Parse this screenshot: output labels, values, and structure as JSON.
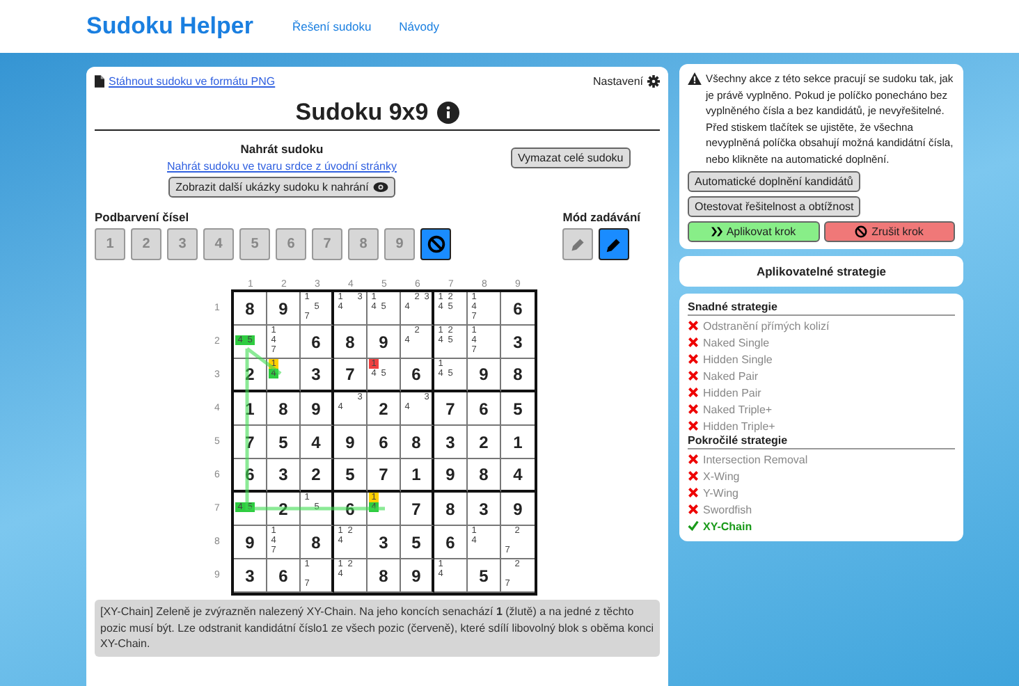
{
  "nav": {
    "brand": "Sudoku Helper",
    "links": [
      "Řešení sudoku",
      "Návody"
    ]
  },
  "editor": {
    "download_link": "Stáhnout sudoku ve formátu PNG",
    "settings": "Nastavení",
    "title": "Sudoku 9x9",
    "upload": {
      "heading": "Nahrát sudoku",
      "link": "Nahrát sudoku ve tvaru srdce z úvodní stránky",
      "button": "Zobrazit další ukázky sudoku k nahrání"
    },
    "clear_button": "Vymazat celé sudoku",
    "coloring": {
      "label": "Podbarvení čísel",
      "buttons": [
        {
          "kind": "digit",
          "label": "1",
          "selected": false
        },
        {
          "kind": "digit",
          "label": "2",
          "selected": false
        },
        {
          "kind": "digit",
          "label": "3",
          "selected": false
        },
        {
          "kind": "digit",
          "label": "4",
          "selected": false
        },
        {
          "kind": "digit",
          "label": "5",
          "selected": false
        },
        {
          "kind": "digit",
          "label": "6",
          "selected": false
        },
        {
          "kind": "digit",
          "label": "7",
          "selected": false
        },
        {
          "kind": "digit",
          "label": "8",
          "selected": false
        },
        {
          "kind": "digit",
          "label": "9",
          "selected": false
        },
        {
          "kind": "none",
          "selected": true
        }
      ]
    },
    "input_mode": {
      "label": "Mód zadávání",
      "buttons": [
        {
          "kind": "pen",
          "selected": false
        },
        {
          "kind": "pencil",
          "selected": true
        }
      ]
    },
    "column_headers": [
      "1",
      "2",
      "3",
      "4",
      "5",
      "6",
      "7",
      "8",
      "9"
    ],
    "row_headers": [
      "1",
      "2",
      "3",
      "4",
      "5",
      "6",
      "7",
      "8",
      "9"
    ],
    "grid": [
      [
        {
          "value": "8"
        },
        {
          "value": "9"
        },
        {
          "candidates": [
            {
              "digit": "1"
            },
            {
              "digit": "5"
            },
            {
              "digit": "7"
            }
          ]
        },
        {
          "candidates": [
            {
              "digit": "1"
            },
            {
              "digit": "3"
            },
            {
              "digit": "4"
            }
          ]
        },
        {
          "candidates": [
            {
              "digit": "1"
            },
            {
              "digit": "4"
            },
            {
              "digit": "5"
            }
          ]
        },
        {
          "candidates": [
            {
              "digit": "2"
            },
            {
              "digit": "3"
            },
            {
              "digit": "4"
            }
          ]
        },
        {
          "candidates": [
            {
              "digit": "1"
            },
            {
              "digit": "2"
            },
            {
              "digit": "4"
            },
            {
              "digit": "5"
            }
          ]
        },
        {
          "candidates": [
            {
              "digit": "1"
            },
            {
              "digit": "4"
            },
            {
              "digit": "7"
            }
          ]
        },
        {
          "value": "6"
        }
      ],
      [
        {
          "candidates": [
            {
              "digit": "4",
              "color": "#2ecc40"
            },
            {
              "digit": "5",
              "color": "#2ecc40"
            }
          ]
        },
        {
          "candidates": [
            {
              "digit": "1"
            },
            {
              "digit": "4"
            },
            {
              "digit": "7"
            }
          ]
        },
        {
          "value": "6"
        },
        {
          "value": "8"
        },
        {
          "value": "9"
        },
        {
          "candidates": [
            {
              "digit": "2"
            },
            {
              "digit": "4"
            }
          ]
        },
        {
          "candidates": [
            {
              "digit": "1"
            },
            {
              "digit": "2"
            },
            {
              "digit": "4"
            },
            {
              "digit": "5"
            }
          ]
        },
        {
          "candidates": [
            {
              "digit": "1"
            },
            {
              "digit": "4"
            },
            {
              "digit": "7"
            }
          ]
        },
        {
          "value": "3"
        }
      ],
      [
        {
          "value": "2"
        },
        {
          "candidates": [
            {
              "digit": "1",
              "color": "#ffd000"
            },
            {
              "digit": "4",
              "color": "#2ecc40"
            }
          ]
        },
        {
          "value": "3"
        },
        {
          "value": "7"
        },
        {
          "candidates": [
            {
              "digit": "1",
              "color": "#f04040"
            },
            {
              "digit": "4"
            },
            {
              "digit": "5"
            }
          ]
        },
        {
          "value": "6"
        },
        {
          "candidates": [
            {
              "digit": "1"
            },
            {
              "digit": "4"
            },
            {
              "digit": "5"
            }
          ]
        },
        {
          "value": "9"
        },
        {
          "value": "8"
        }
      ],
      [
        {
          "value": "1"
        },
        {
          "value": "8"
        },
        {
          "value": "9"
        },
        {
          "candidates": [
            {
              "digit": "3"
            },
            {
              "digit": "4"
            }
          ]
        },
        {
          "value": "2"
        },
        {
          "candidates": [
            {
              "digit": "3"
            },
            {
              "digit": "4"
            }
          ]
        },
        {
          "value": "7"
        },
        {
          "value": "6"
        },
        {
          "value": "5"
        }
      ],
      [
        {
          "value": "7"
        },
        {
          "value": "5"
        },
        {
          "value": "4"
        },
        {
          "value": "9"
        },
        {
          "value": "6"
        },
        {
          "value": "8"
        },
        {
          "value": "3"
        },
        {
          "value": "2"
        },
        {
          "value": "1"
        }
      ],
      [
        {
          "value": "6"
        },
        {
          "value": "3"
        },
        {
          "value": "2"
        },
        {
          "value": "5"
        },
        {
          "value": "7"
        },
        {
          "value": "1"
        },
        {
          "value": "9"
        },
        {
          "value": "8"
        },
        {
          "value": "4"
        }
      ],
      [
        {
          "candidates": [
            {
              "digit": "4",
              "color": "#2ecc40"
            },
            {
              "digit": "5",
              "color": "#2ecc40"
            }
          ]
        },
        {
          "value": "2"
        },
        {
          "candidates": [
            {
              "digit": "1"
            },
            {
              "digit": "5"
            }
          ]
        },
        {
          "value": "6"
        },
        {
          "candidates": [
            {
              "digit": "1",
              "color": "#ffd000"
            },
            {
              "digit": "4",
              "color": "#2ecc40"
            }
          ]
        },
        {
          "value": "7"
        },
        {
          "value": "8"
        },
        {
          "value": "3"
        },
        {
          "value": "9"
        }
      ],
      [
        {
          "value": "9"
        },
        {
          "candidates": [
            {
              "digit": "1"
            },
            {
              "digit": "4"
            },
            {
              "digit": "7"
            }
          ]
        },
        {
          "value": "8"
        },
        {
          "candidates": [
            {
              "digit": "1"
            },
            {
              "digit": "2"
            },
            {
              "digit": "4"
            }
          ]
        },
        {
          "value": "3"
        },
        {
          "value": "5"
        },
        {
          "value": "6"
        },
        {
          "candidates": [
            {
              "digit": "1"
            },
            {
              "digit": "4"
            }
          ]
        },
        {
          "candidates": [
            {
              "digit": "2"
            },
            {
              "digit": "7"
            }
          ]
        }
      ],
      [
        {
          "value": "3"
        },
        {
          "value": "6"
        },
        {
          "candidates": [
            {
              "digit": "1"
            },
            {
              "digit": "7"
            }
          ]
        },
        {
          "candidates": [
            {
              "digit": "1"
            },
            {
              "digit": "2"
            },
            {
              "digit": "4"
            }
          ]
        },
        {
          "value": "8"
        },
        {
          "value": "9"
        },
        {
          "candidates": [
            {
              "digit": "1"
            },
            {
              "digit": "4"
            }
          ]
        },
        {
          "value": "5"
        },
        {
          "candidates": [
            {
              "digit": "2"
            },
            {
              "digit": "7"
            }
          ]
        }
      ]
    ],
    "explanation": "[XY-Chain] Zeleně je zvýrazněn nalezený XY-Chain. Na jeho koncích senachází **1** (žlutě) a na jedné z těchto pozic musí být. Lze odstranit kandidátní číslo1 ze všech pozic (červeně), které sdílí libovolný blok s oběma konci XY-Chain."
  },
  "actions": {
    "warning": "Všechny akce z této sekce pracují se sudoku tak, jak je právě vyplněno. Pokud je políčko ponecháno bez vyplněného čísla a bez kandidátů, je nevyřešitelné. Před stiskem tlačítek se ujistěte, že všechna nevyplněná políčka obsahují možná kandidátní čísla, nebo klikněte na automatické doplnění.",
    "buttons": [
      "Automatické doplnění kandidátů",
      "Otestovat řešitelnost a obtížnost"
    ],
    "apply": "Aplikovat krok",
    "cancel": "Zrušit krok"
  },
  "strategies": {
    "title": "Aplikovatelné strategie",
    "groups": [
      {
        "heading": "Snadné strategie",
        "items": [
          {
            "name": "Odstranění přímých kolizí",
            "applicable": false
          },
          {
            "name": "Naked Single",
            "applicable": false
          },
          {
            "name": "Hidden Single",
            "applicable": false
          },
          {
            "name": "Naked Pair",
            "applicable": false
          },
          {
            "name": "Hidden Pair",
            "applicable": false
          },
          {
            "name": "Naked Triple+",
            "applicable": false
          },
          {
            "name": "Hidden Triple+",
            "applicable": false
          }
        ]
      },
      {
        "heading": "Pokročilé strategie",
        "items": [
          {
            "name": "Intersection Removal",
            "applicable": false
          },
          {
            "name": "X-Wing",
            "applicable": false
          },
          {
            "name": "Y-Wing",
            "applicable": false
          },
          {
            "name": "Swordfish",
            "applicable": false
          },
          {
            "name": "XY-Chain",
            "applicable": true
          }
        ]
      }
    ]
  }
}
